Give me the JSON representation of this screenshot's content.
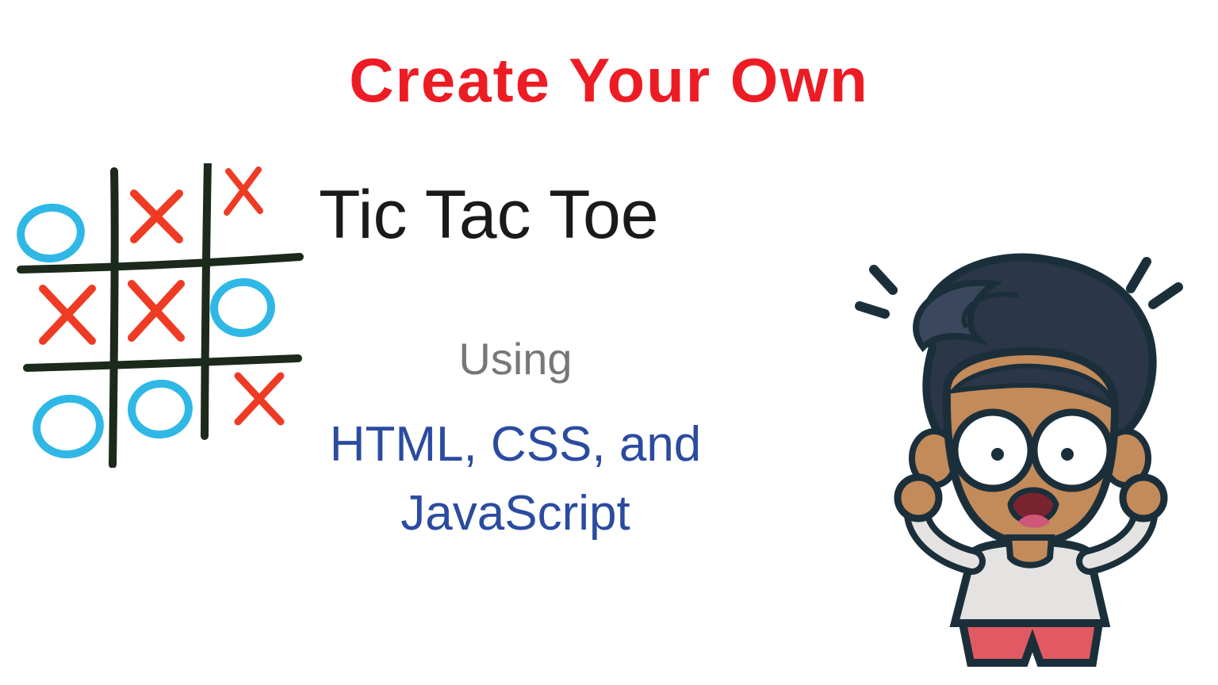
{
  "header": {
    "title": "Create Your Own"
  },
  "main": {
    "subtitle": "Tic Tac Toe",
    "using_label": "Using",
    "tech_label_line1": "HTML, CSS, and",
    "tech_label_line2": "JavaScript"
  },
  "colors": {
    "title_red": "#ed1c24",
    "subtitle_black": "#1a1a1a",
    "using_gray": "#777777",
    "tech_blue": "#2a4ba0",
    "board_line": "#1b2a1b",
    "board_x": "#ef3b24",
    "board_o": "#2fb8e6"
  },
  "board": {
    "grid": [
      [
        "O",
        "X",
        "X"
      ],
      [
        "X",
        "X",
        "O"
      ],
      [
        "O",
        "O",
        "X"
      ]
    ]
  },
  "illustration": {
    "name": "excited-cartoon-boy"
  }
}
